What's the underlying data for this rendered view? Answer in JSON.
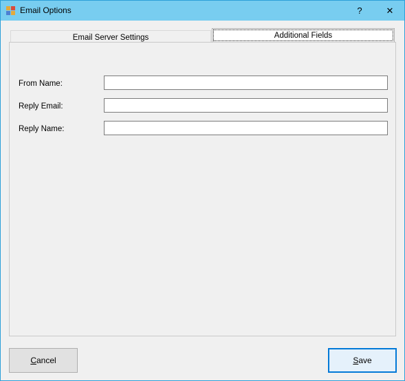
{
  "window": {
    "title": "Email Options",
    "help_glyph": "?",
    "close_glyph": "✕",
    "app_icon": "app-icon",
    "titlebar_color": "#78cdf0"
  },
  "tabs": [
    {
      "label": "Email Server Settings",
      "selected": false
    },
    {
      "label": "Additional Fields",
      "selected": true
    }
  ],
  "fields": [
    {
      "label": "From Name:",
      "value": ""
    },
    {
      "label": "Reply Email:",
      "value": ""
    },
    {
      "label": "Reply Name:",
      "value": ""
    }
  ],
  "buttons": {
    "cancel": {
      "mnemonic": "C",
      "rest": "ancel"
    },
    "save": {
      "mnemonic": "S",
      "rest": "ave"
    }
  },
  "colors": {
    "accent": "#0078d7"
  }
}
